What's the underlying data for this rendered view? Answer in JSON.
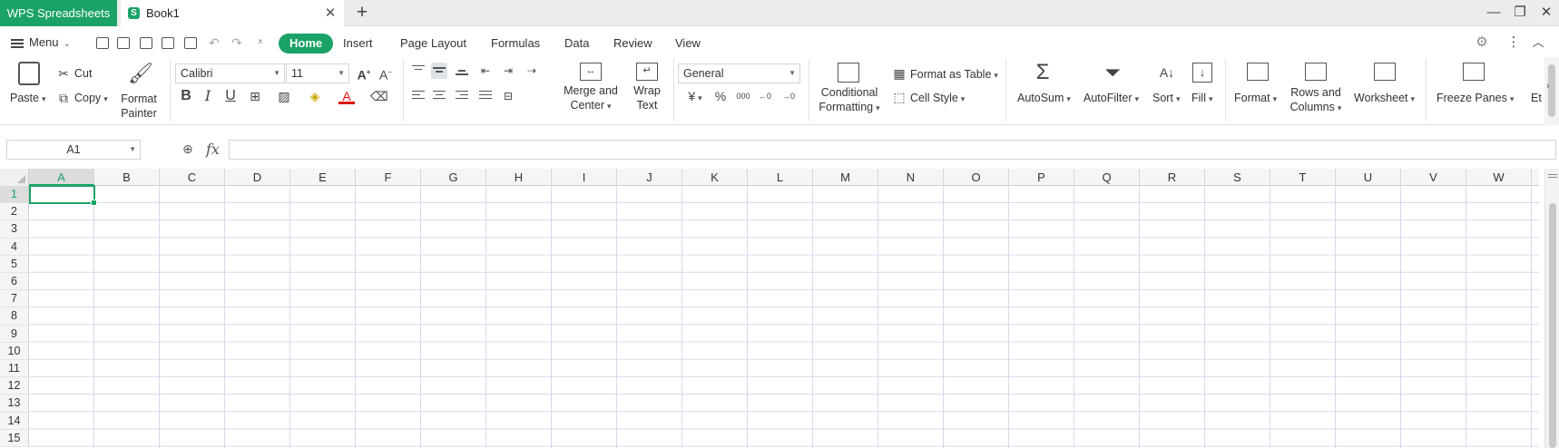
{
  "titlebar": {
    "app_tab": "WPS Spreadsheets",
    "book_tab": "Book1",
    "book_logo": "S",
    "close_glyph": "✕",
    "add_glyph": "+",
    "minimize": "—",
    "restore": "❐",
    "close": "✕"
  },
  "menu": {
    "menu_label": "Menu",
    "tabs": [
      {
        "label": "Home",
        "active": true
      },
      {
        "label": "Insert"
      },
      {
        "label": "Page Layout"
      },
      {
        "label": "Formulas"
      },
      {
        "label": "Data"
      },
      {
        "label": "Review"
      },
      {
        "label": "View"
      }
    ]
  },
  "ribbon": {
    "paste": "Paste",
    "cut": "Cut",
    "copy": "Copy",
    "format_painter_1": "Format",
    "format_painter_2": "Painter",
    "font_name": "Calibri",
    "font_size": "11",
    "bold": "B",
    "italic": "I",
    "underline": "U",
    "merge_1": "Merge and",
    "merge_2": "Center",
    "wrap_1": "Wrap",
    "wrap_2": "Text",
    "number_format": "General",
    "currency": "¥",
    "percent": "%",
    "thousands": "000",
    "cond_1": "Conditional",
    "cond_2": "Formatting",
    "format_as_table": "Format as Table",
    "cell_style": "Cell Style",
    "autosum": "AutoSum",
    "autofilter": "AutoFilter",
    "sort": "Sort",
    "fill": "Fill",
    "format": "Format",
    "rows_cols_1": "Rows and",
    "rows_cols_2": "Columns",
    "worksheet": "Worksheet",
    "freeze_panes": "Freeze Panes",
    "more": "Et"
  },
  "formula_bar": {
    "cell_ref": "A1",
    "fx": "fx",
    "value": ""
  },
  "sheet": {
    "columns": [
      "A",
      "B",
      "C",
      "D",
      "E",
      "F",
      "G",
      "H",
      "I",
      "J",
      "K",
      "L",
      "M",
      "N",
      "O",
      "P",
      "Q",
      "R",
      "S",
      "T",
      "U",
      "V",
      "W"
    ],
    "rows": [
      "1",
      "2",
      "3",
      "4",
      "5",
      "6",
      "7",
      "8",
      "9",
      "10",
      "11",
      "12",
      "13",
      "14",
      "15"
    ],
    "selected_cell": "A1"
  },
  "colors": {
    "accent": "#1aa267",
    "gridline": "#d8d8ec"
  }
}
